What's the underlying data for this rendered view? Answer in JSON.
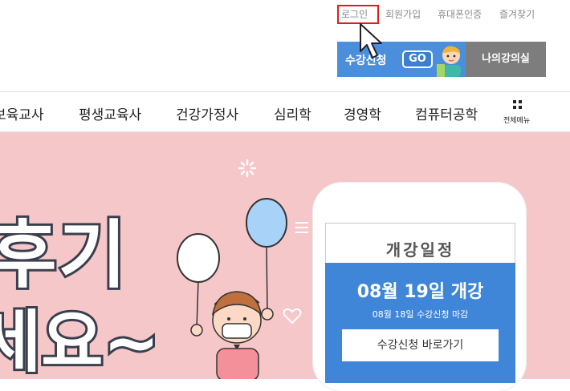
{
  "util_links": [
    "로그인",
    "회원가입",
    "휴대폰인증",
    "즐겨찾기"
  ],
  "registration": {
    "label": "수강신청",
    "go": "GO",
    "my_room": "나의강의실"
  },
  "nav": {
    "items": [
      "보육교사",
      "평생교육사",
      "건강가정사",
      "심리학",
      "경영학",
      "컴퓨터공학"
    ],
    "all_menu": "전체메뉴"
  },
  "hero": {
    "headline_line1": "후기",
    "headline_line2": "세요~",
    "card": {
      "title": "개강일정",
      "date": "08월 19일 개강",
      "deadline": "08월 18일 수강신청 마감",
      "button": "수강신청 바로가기"
    }
  },
  "colors": {
    "accent_blue": "#3f86d9",
    "highlight_red": "#e01d1d",
    "hero_bg": "#f6c7c9",
    "my_room_gray": "#7d7d7d"
  },
  "icons": [
    "cursor-arrow-icon",
    "grid-menu-icon",
    "sparkle-icon",
    "heart-icon",
    "balloon-icon",
    "student-character-icon"
  ]
}
